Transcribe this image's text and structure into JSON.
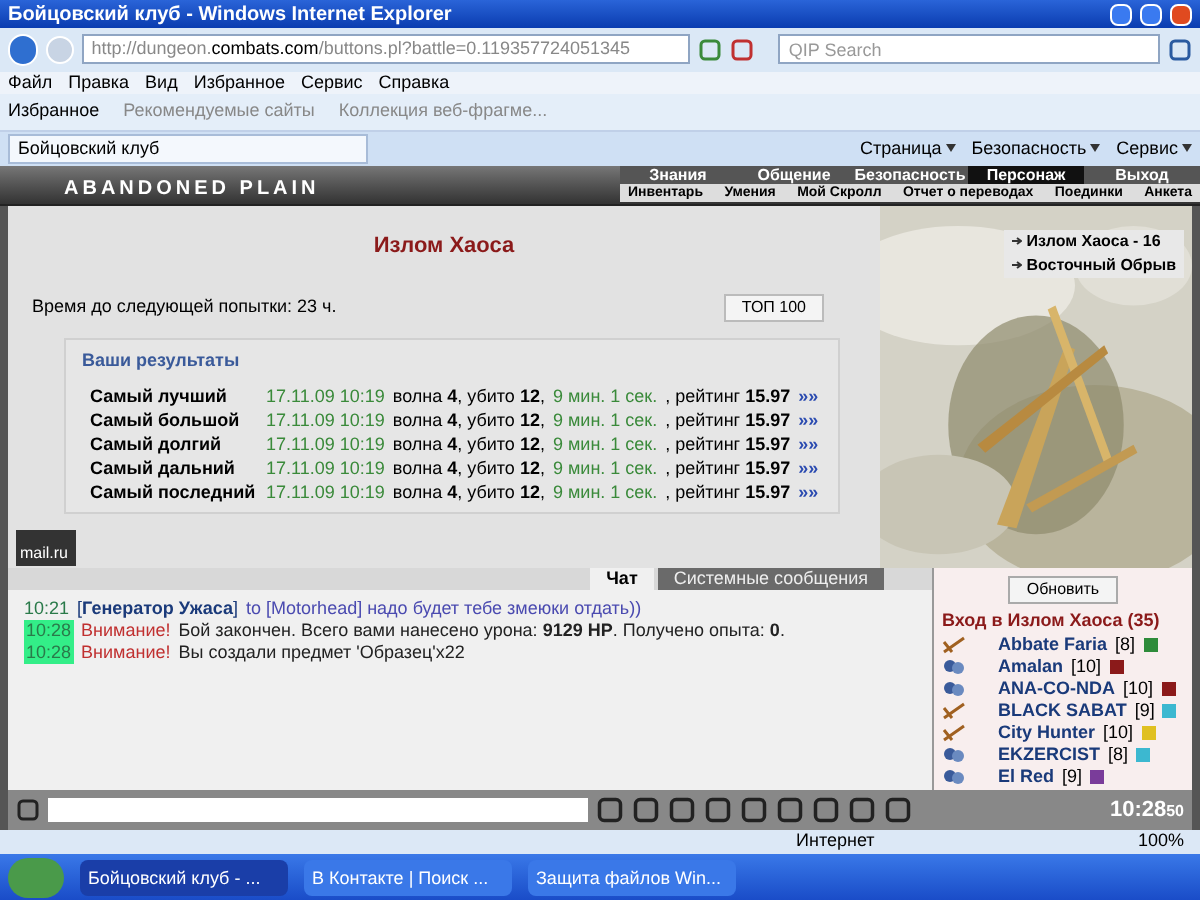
{
  "window": {
    "title": "Бойцовский клуб - Windows Internet Explorer"
  },
  "address": {
    "url_prefix": "http://dungeon.",
    "url_host": "combats.com",
    "url_path": "/buttons.pl?battle=0.119357724051345"
  },
  "search": {
    "placeholder": "QIP Search"
  },
  "menu": [
    "Файл",
    "Правка",
    "Вид",
    "Избранное",
    "Сервис",
    "Справка"
  ],
  "favorites": {
    "label": "Избранное",
    "links": [
      "Рекомендуемые сайты",
      "Коллекция веб-фрагме..."
    ]
  },
  "tab": {
    "label": "Бойцовский клуб"
  },
  "command_bar": [
    "Страница",
    "Безопасность",
    "Сервис"
  ],
  "game": {
    "logo": "ABANDONED PLAIN",
    "nav_top": [
      {
        "label": "Знания",
        "selected": false
      },
      {
        "label": "Общение",
        "selected": false
      },
      {
        "label": "Безопасность",
        "selected": false
      },
      {
        "label": "Персонаж",
        "selected": true
      },
      {
        "label": "Выход",
        "selected": false
      }
    ],
    "nav_sub": [
      "Инвентарь",
      "Умения",
      "Мой Скролл",
      "Отчет о переводах",
      "Поединки",
      "Анкета"
    ]
  },
  "page": {
    "title": "Излом Хаоса",
    "locations": [
      "Излом Хаоса - 16",
      "Восточный Обрыв"
    ],
    "timer": "Время до следующей попытки: 23 ч.",
    "top_button": "ТОП 100",
    "results": {
      "title": "Ваши результаты",
      "rows": [
        {
          "label": "Самый лучший",
          "date": "17.11.09 10:19",
          "summary": "волна **4**, убито **12**,",
          "duration": "9 мин. 1 сек.",
          "rating": ", рейтинг **15.97**",
          "link": "»»"
        },
        {
          "label": "Самый большой",
          "date": "17.11.09 10:19",
          "summary": "волна **4**, убито **12**,",
          "duration": "9 мин. 1 сек.",
          "rating": ", рейтинг **15.97**",
          "link": "»»"
        },
        {
          "label": "Самый долгий",
          "date": "17.11.09 10:19",
          "summary": "волна **4**, убито **12**,",
          "duration": "9 мин. 1 сек.",
          "rating": ", рейтинг **15.97**",
          "link": "»»"
        },
        {
          "label": "Самый дальний",
          "date": "17.11.09 10:19",
          "summary": "волна **4**, убито **12**,",
          "duration": "9 мин. 1 сек.",
          "rating": ", рейтинг **15.97**",
          "link": "»»"
        },
        {
          "label": "Самый последний",
          "date": "17.11.09 10:19",
          "summary": "волна **4**, убито **12**,",
          "duration": "9 мин. 1 сек.",
          "rating": ", рейтинг **15.97**",
          "link": "»»"
        }
      ]
    },
    "counter": "mail.ru"
  },
  "chat": {
    "tabs": [
      {
        "label": "Чат",
        "selected": true
      },
      {
        "label": "Системные сообщения",
        "selected": false
      }
    ],
    "messages": [
      {
        "kind": "chat",
        "time": "10:21",
        "sender": "[**Генератор Ужаса**]",
        "text": "to [Motorhead] надо будет тебе змеюки отдать))"
      },
      {
        "kind": "system",
        "time": "10:28",
        "prefix": "Внимание!",
        "text": "Бой закончен. Всего вами нанесено урона: **9129 HP**. Получено опыта: **0**."
      },
      {
        "kind": "system",
        "time": "10:28",
        "prefix": "Внимание!",
        "text": "Вы создали предмет 'Образец'x22"
      }
    ]
  },
  "players": {
    "refresh": "Обновить",
    "title": "Вход в Излом Хаоса (35)",
    "items": [
      {
        "kind": "attack",
        "name": "Abbate Faria",
        "level": "[8]",
        "color": "#2e8b3a"
      },
      {
        "kind": "group",
        "name": "Amalan",
        "level": "[10]",
        "color": "#8b1a1a"
      },
      {
        "kind": "group",
        "name": "ANA-CO-NDA",
        "level": "[10]",
        "color": "#8b1a1a"
      },
      {
        "kind": "attack",
        "name": "BLACK SABAT",
        "level": "[9]",
        "color": "#3cb8d0"
      },
      {
        "kind": "attack",
        "name": "City Hunter",
        "level": "[10]",
        "color": "#e0c020"
      },
      {
        "kind": "group",
        "name": "EKZERCIST",
        "level": "[8]",
        "color": "#3cb8d0"
      },
      {
        "kind": "group",
        "name": "El Red",
        "level": "[9]",
        "color": "#7a3c9a"
      }
    ]
  },
  "clock": {
    "time": "10:28",
    "seconds": "50"
  },
  "status": {
    "zone": "Интернет",
    "zoom": "100%"
  },
  "taskbar": [
    {
      "label": "Бойцовский клуб - ...",
      "selected": true
    },
    {
      "label": "В Контакте | Поиск ...",
      "selected": false
    },
    {
      "label": "Защита файлов Win...",
      "selected": false
    }
  ]
}
